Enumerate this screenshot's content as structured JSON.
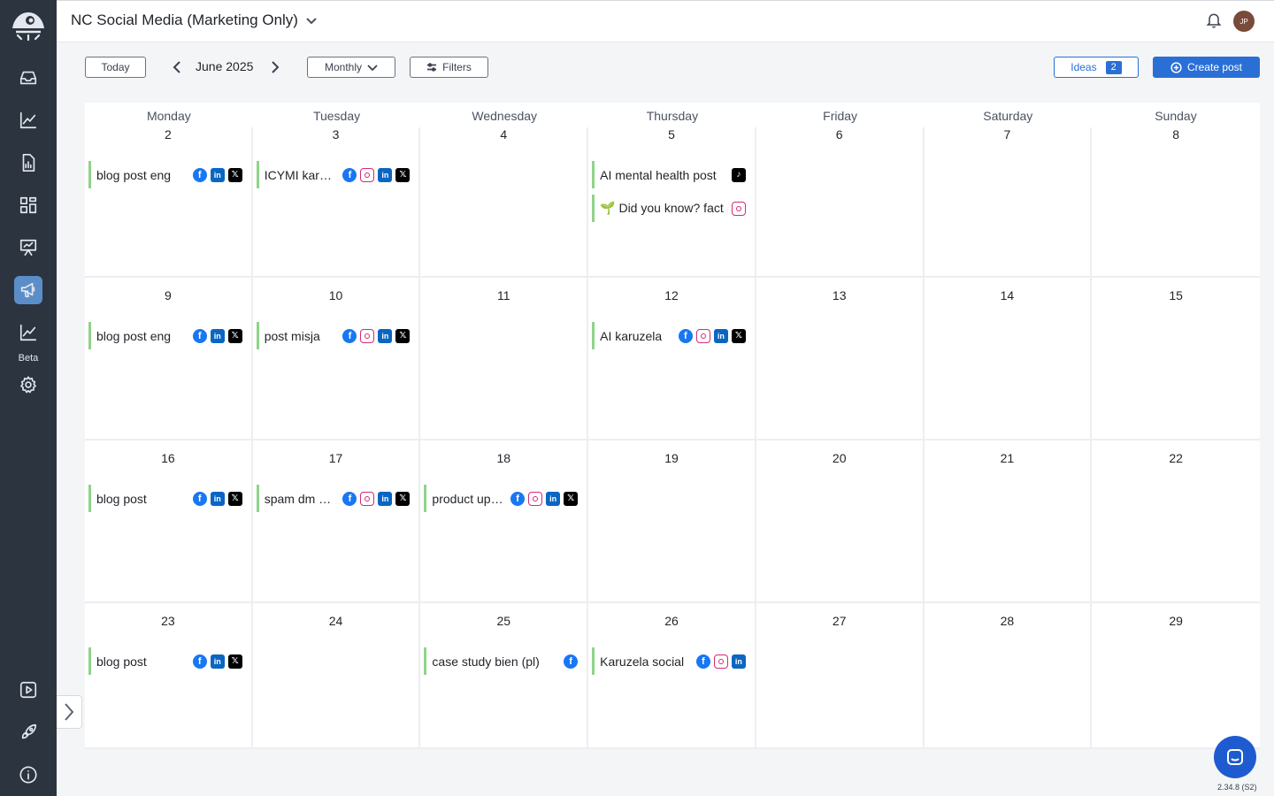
{
  "workspace": {
    "title": "NC Social Media (Marketing Only)"
  },
  "user": {
    "initials": "JP"
  },
  "sidebar": {
    "items": [
      {
        "icon": "inbox-icon"
      },
      {
        "icon": "analytics-icon"
      },
      {
        "icon": "reports-icon"
      },
      {
        "icon": "dashboard-icon"
      },
      {
        "icon": "presentation-icon"
      },
      {
        "icon": "megaphone-icon",
        "active": true
      },
      {
        "icon": "trend-icon"
      },
      {
        "icon": "settings-icon"
      },
      {
        "icon": "video-icon"
      },
      {
        "icon": "rocket-icon"
      },
      {
        "icon": "info-icon"
      }
    ],
    "beta_label": "Beta"
  },
  "toolbar": {
    "today_label": "Today",
    "month_label": "June 2025",
    "view_label": "Monthly",
    "filters_label": "Filters",
    "ideas_label": "Ideas",
    "ideas_count": "2",
    "create_label": "Create post"
  },
  "calendar": {
    "weekdays": [
      "Monday",
      "Tuesday",
      "Wednesday",
      "Thursday",
      "Friday",
      "Saturday",
      "Sunday"
    ],
    "weeks": [
      [
        {
          "day": "2",
          "posts": [
            {
              "text": "blog post eng",
              "networks": [
                "facebook",
                "linkedin",
                "x"
              ]
            }
          ]
        },
        {
          "day": "3",
          "posts": [
            {
              "text": "ICYMI karuzela",
              "networks": [
                "facebook",
                "instagram",
                "linkedin",
                "x"
              ]
            }
          ]
        },
        {
          "day": "4",
          "posts": []
        },
        {
          "day": "5",
          "posts": [
            {
              "text": "AI mental health post",
              "networks": [
                "tiktok"
              ]
            },
            {
              "text": "🌱 Did you know? fact",
              "networks": [
                "instagram"
              ]
            }
          ]
        },
        {
          "day": "6",
          "posts": []
        },
        {
          "day": "7",
          "posts": []
        },
        {
          "day": "8",
          "posts": []
        }
      ],
      [
        {
          "day": "9",
          "posts": [
            {
              "text": "blog post eng",
              "networks": [
                "facebook",
                "linkedin",
                "x"
              ]
            }
          ]
        },
        {
          "day": "10",
          "posts": [
            {
              "text": "post misja",
              "networks": [
                "facebook",
                "instagram",
                "linkedin",
                "x"
              ]
            }
          ]
        },
        {
          "day": "11",
          "posts": []
        },
        {
          "day": "12",
          "posts": [
            {
              "text": "AI karuzela",
              "networks": [
                "facebook",
                "instagram",
                "linkedin",
                "x"
              ]
            }
          ]
        },
        {
          "day": "13",
          "posts": []
        },
        {
          "day": "14",
          "posts": []
        },
        {
          "day": "15",
          "posts": []
        }
      ],
      [
        {
          "day": "16",
          "posts": [
            {
              "text": "blog post",
              "networks": [
                "facebook",
                "linkedin",
                "x"
              ]
            }
          ]
        },
        {
          "day": "17",
          "posts": [
            {
              "text": "spam dm alert",
              "networks": [
                "facebook",
                "instagram",
                "linkedin",
                "x"
              ]
            }
          ]
        },
        {
          "day": "18",
          "posts": [
            {
              "text": "product update",
              "networks": [
                "facebook",
                "instagram",
                "linkedin",
                "x"
              ]
            }
          ]
        },
        {
          "day": "19",
          "posts": []
        },
        {
          "day": "20",
          "posts": []
        },
        {
          "day": "21",
          "posts": []
        },
        {
          "day": "22",
          "posts": []
        }
      ],
      [
        {
          "day": "23",
          "posts": [
            {
              "text": "blog post",
              "networks": [
                "facebook",
                "linkedin",
                "x"
              ]
            }
          ]
        },
        {
          "day": "24",
          "posts": []
        },
        {
          "day": "25",
          "posts": [
            {
              "text": "case study bien (pl)",
              "networks": [
                "facebook"
              ]
            }
          ]
        },
        {
          "day": "26",
          "posts": [
            {
              "text": "Karuzela social",
              "networks": [
                "facebook",
                "instagram",
                "linkedin"
              ]
            }
          ]
        },
        {
          "day": "27",
          "posts": []
        },
        {
          "day": "28",
          "posts": []
        },
        {
          "day": "29",
          "posts": []
        }
      ]
    ]
  },
  "footer": {
    "version": "2.34.8 (S2)"
  },
  "colors": {
    "accent": "#2a6fd6",
    "sidebar": "#2c3440",
    "post_marker": "#8fd38a"
  }
}
